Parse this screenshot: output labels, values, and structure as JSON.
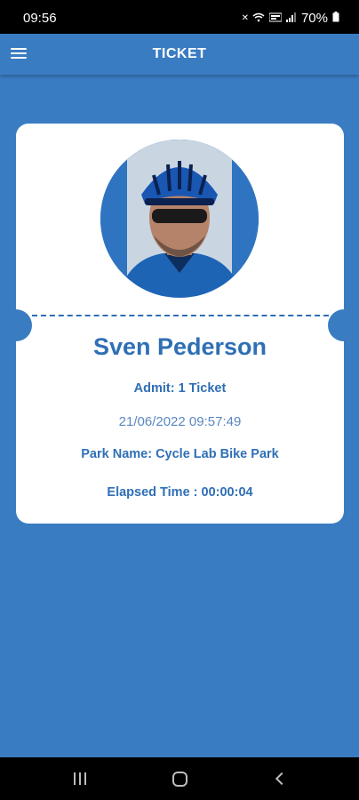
{
  "status_bar": {
    "time": "09:56",
    "battery": "70%",
    "icons": [
      "mute-icon",
      "wifi-icon",
      "volte-icon",
      "signal-icon",
      "battery-icon"
    ]
  },
  "app_bar": {
    "title": "TICKET",
    "menu_icon": "hamburger-menu-icon"
  },
  "ticket": {
    "name": "Sven Pederson",
    "admit": "Admit: 1 Ticket",
    "datetime": "21/06/2022 09:57:49",
    "park_name": "Park Name: Cycle Lab Bike Park",
    "elapsed": "Elapsed Time : 00:00:04"
  },
  "nav_bar": {
    "buttons": [
      "recents",
      "home",
      "back"
    ]
  },
  "colors": {
    "primary": "#3a7cc2",
    "text_primary": "#2f6fb5",
    "text_secondary": "#5a87c0",
    "card": "#ffffff"
  }
}
